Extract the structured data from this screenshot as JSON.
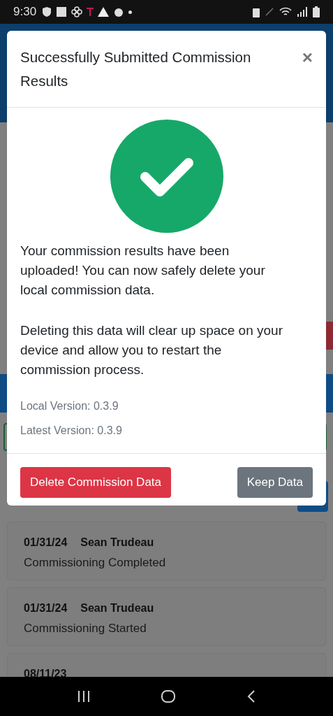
{
  "status_bar": {
    "time": "9:30"
  },
  "modal": {
    "title": "Successfully Submitted Commission Results",
    "close": "×",
    "paragraphs": [
      "Your commission results have been uploaded! You can now safely delete your local commission data.",
      "Deleting this data will clear up space on your device and allow you to restart the commission process."
    ],
    "versions": [
      "Local Version: 0.3.9",
      "Latest Version: 0.3.9"
    ],
    "buttons": [
      {
        "label": "Delete Commission Data",
        "kind": "danger"
      },
      {
        "label": "Keep Data",
        "kind": "secondary"
      }
    ]
  },
  "history": [
    {
      "date": "01/31/24",
      "user": "Sean Trudeau",
      "event": "Commissioning Completed"
    },
    {
      "date": "01/31/24",
      "user": "Sean Trudeau",
      "event": "Commissioning Started"
    },
    {
      "date": "08/11/23"
    }
  ]
}
